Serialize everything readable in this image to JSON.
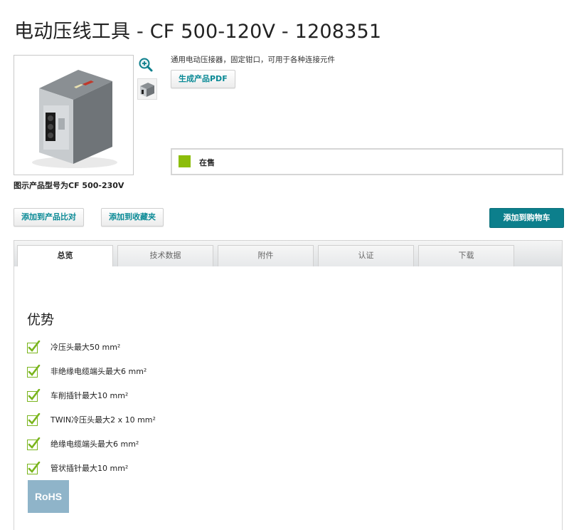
{
  "page": {
    "title": "电动压线工具 - CF 500-120V - 1208351",
    "short_description": "通用电动压接器，固定钳口，可用于各种连接元件",
    "image_caption": "图示产品型号为CF 500-230V"
  },
  "buttons": {
    "pdf": "生成产品PDF",
    "compare": "添加到产品比对",
    "favorites": "添加到收藏夹",
    "cart": "添加到购物车"
  },
  "availability": {
    "label": "在售",
    "color": "#8cbd0a"
  },
  "tabs": [
    {
      "label": "总览",
      "active": true
    },
    {
      "label": "技术数据",
      "active": false
    },
    {
      "label": "附件",
      "active": false
    },
    {
      "label": "认证",
      "active": false
    },
    {
      "label": "下载",
      "active": false
    }
  ],
  "advantages": {
    "title": "优势",
    "items": [
      "冷压头最大50 mm²",
      "非绝缘电缆端头最大6 mm²",
      "车削插针最大10 mm²",
      "TWIN冷压头最大2 x 10 mm²",
      "绝缘电缆端头最大6 mm²",
      "管状插针最大10 mm²"
    ]
  },
  "badges": {
    "rohs": "RoHS"
  },
  "colors": {
    "accent": "#0c7f8c",
    "link_text": "#0a8a96",
    "check_green": "#7ab51d"
  },
  "icons": {
    "zoom": "zoom-in-icon",
    "check": "checkmark-icon"
  }
}
